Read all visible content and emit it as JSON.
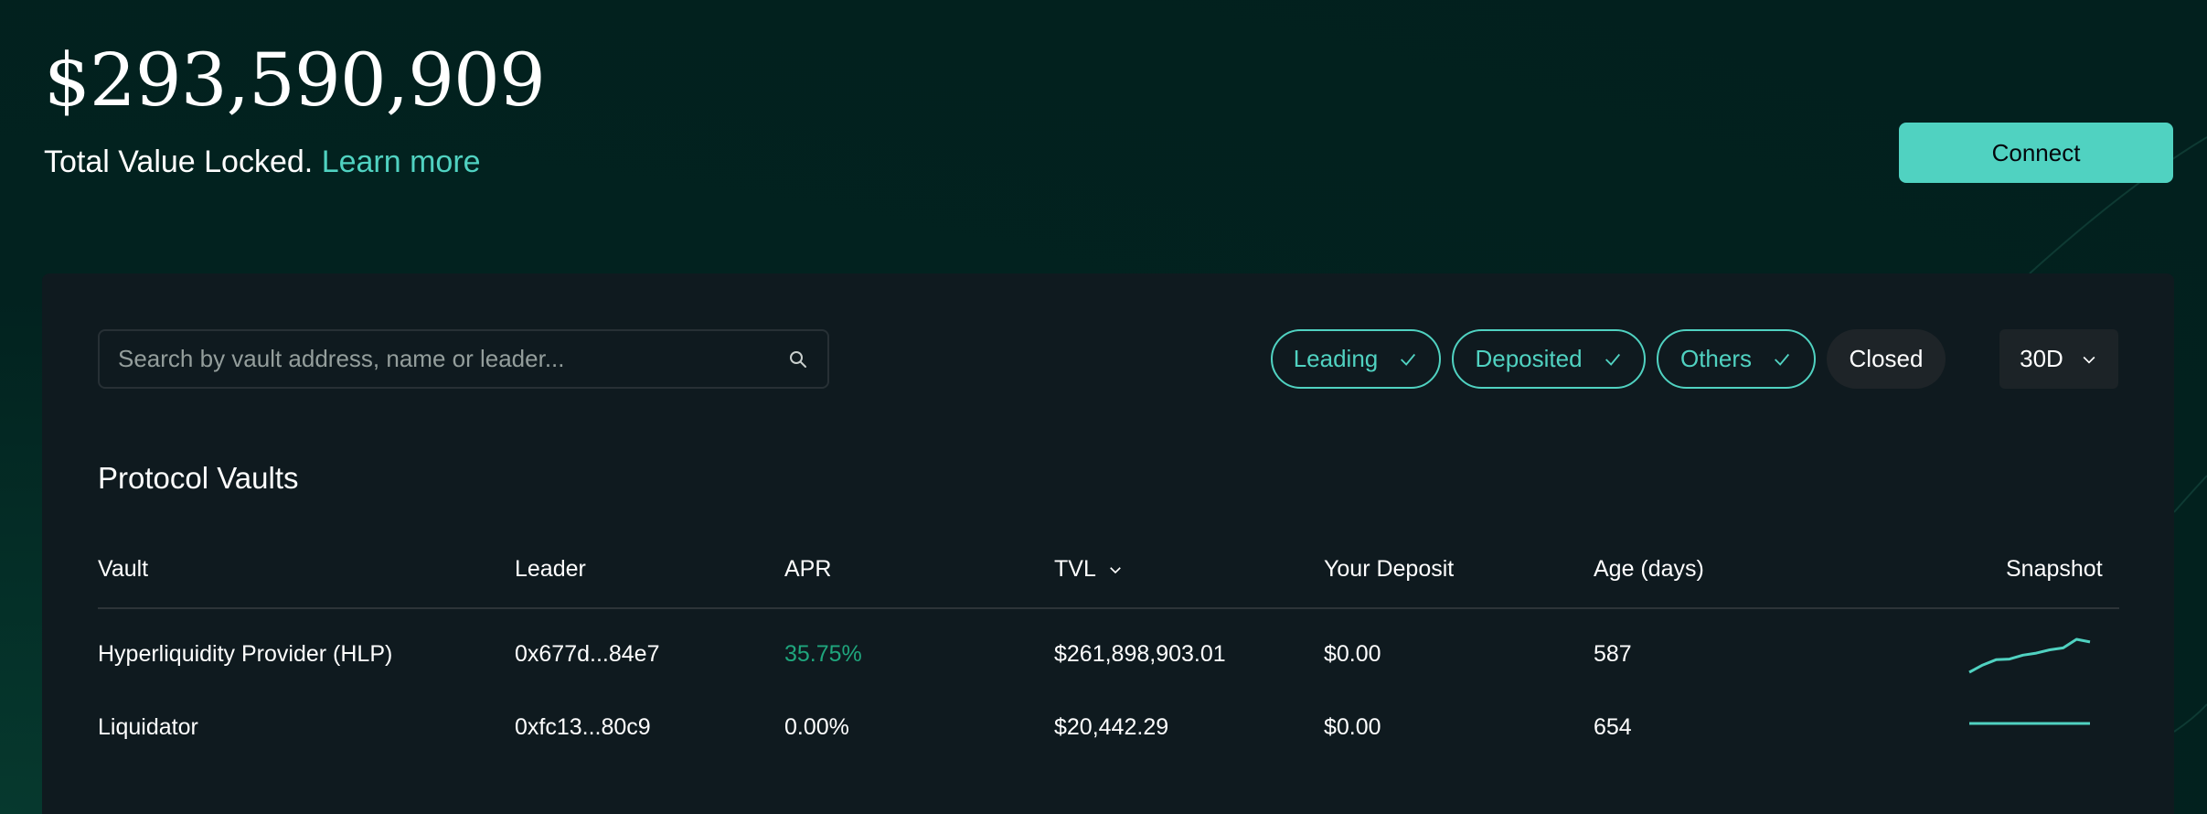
{
  "header": {
    "tvl_amount": "$293,590,909",
    "tvl_caption": "Total Value Locked.",
    "learn_more": "Learn more",
    "connect_label": "Connect"
  },
  "filters": {
    "search_placeholder": "Search by vault address, name or leader...",
    "search_value": "",
    "chips": [
      {
        "label": "Leading",
        "active": true
      },
      {
        "label": "Deposited",
        "active": true
      },
      {
        "label": "Others",
        "active": true
      },
      {
        "label": "Closed",
        "active": false
      }
    ],
    "period": "30D"
  },
  "section_title": "Protocol Vaults",
  "table": {
    "columns": [
      "Vault",
      "Leader",
      "APR",
      "TVL",
      "Your Deposit",
      "Age (days)",
      "Snapshot"
    ],
    "sorted_column": "TVL",
    "rows": [
      {
        "vault": "Hyperliquidity Provider (HLP)",
        "leader": "0x677d...84e7",
        "apr": "35.75%",
        "apr_positive": true,
        "tvl": "$261,898,903.01",
        "deposit": "$0.00",
        "age": "587",
        "snapshot": [
          0.0,
          0.22,
          0.38,
          0.4,
          0.52,
          0.58,
          0.68,
          0.74,
          1.0,
          0.92
        ]
      },
      {
        "vault": "Liquidator",
        "leader": "0xfc13...80c9",
        "apr": "0.00%",
        "apr_positive": false,
        "tvl": "$20,442.29",
        "deposit": "$0.00",
        "age": "654",
        "snapshot": [
          0.5,
          0.5,
          0.5,
          0.5,
          0.5,
          0.5,
          0.5,
          0.5,
          0.5,
          0.5
        ]
      }
    ]
  },
  "colors": {
    "accent": "#50d2c1",
    "positive": "#1fa67d",
    "background": "#02221f",
    "panel": "#0f1a1f"
  }
}
